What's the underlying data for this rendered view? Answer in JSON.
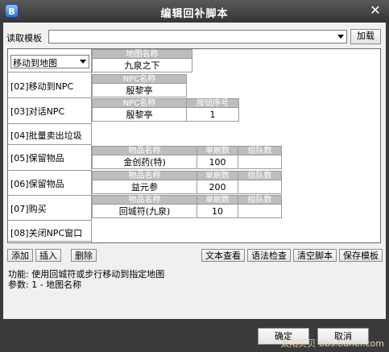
{
  "window": {
    "title": "编辑回补脚本",
    "icon_letter": "B",
    "close_label": "✕"
  },
  "template": {
    "label": "读取模板",
    "value": "",
    "load_button": "加载"
  },
  "steps": [
    {
      "label": "移动到地图",
      "is_dropdown": true,
      "fields": [
        {
          "header": "地图名称",
          "value": "九泉之下"
        }
      ]
    },
    {
      "label": "[02]移动到NPC",
      "fields": [
        {
          "header": "NPC名称",
          "value": "殷黎亭"
        }
      ]
    },
    {
      "label": "[03]对话NPC",
      "fields": [
        {
          "header": "NPC名称",
          "value": "殷黎亭"
        },
        {
          "header": "按钮序号",
          "value": "1"
        }
      ]
    },
    {
      "label": "[04]批量卖出垃圾",
      "fields": []
    },
    {
      "label": "[05]保留物品",
      "fields": [
        {
          "header": "物品名称",
          "value": "金创药(特)"
        },
        {
          "header": "单刷数",
          "value": "100"
        },
        {
          "header": "组队数",
          "value": ""
        }
      ]
    },
    {
      "label": "[06]保留物品",
      "fields": [
        {
          "header": "物品名称",
          "value": "益元参"
        },
        {
          "header": "单刷数",
          "value": "200"
        },
        {
          "header": "组队数",
          "value": ""
        }
      ]
    },
    {
      "label": "[07]购买",
      "fields": [
        {
          "header": "物品名称",
          "value": "回城符(九泉)"
        },
        {
          "header": "单刷数",
          "value": "10"
        },
        {
          "header": "组队数",
          "value": ""
        }
      ]
    },
    {
      "label": "[08]关闭NPC窗口",
      "fields": []
    }
  ],
  "toolbar": {
    "add": "添加",
    "insert": "插入",
    "delete": "删除",
    "view_text": "文本查看",
    "syntax_check": "语法检查",
    "clear_script": "清空脚本",
    "save_template": "保存模板"
  },
  "info": {
    "function_line": "功能: 使用回城符或步行移动到指定地图",
    "params_line": "参数: 1 - 地图名称"
  },
  "footer": {
    "ok": "确定",
    "cancel": "取消",
    "watermark": "太阳贝贝 bbs.tianei.com"
  }
}
